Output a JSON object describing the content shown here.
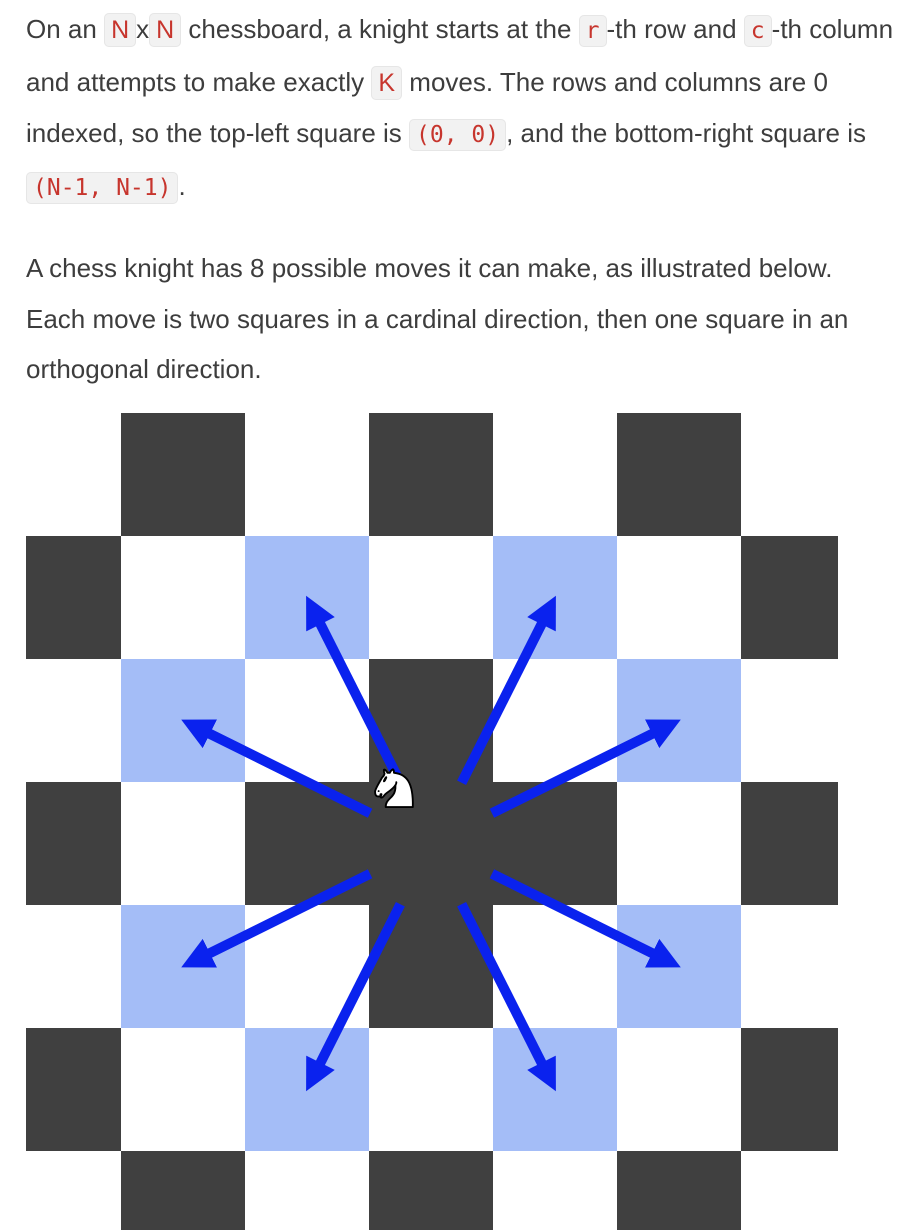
{
  "paragraph1": {
    "t1": "On an ",
    "code_n1": "N",
    "t2": "x",
    "code_n2": "N",
    "t3": " chessboard, a knight starts at the ",
    "code_r": "r",
    "t4": "-th row and ",
    "code_c": "c",
    "t5": "-th column and attempts to make exactly ",
    "code_k": "K",
    "t6": " moves. The rows and columns are 0 indexed, so the top-left square is ",
    "code_origin": "(0, 0)",
    "t7": ", and the bottom-right square is ",
    "code_end": "(N-1, N-1)",
    "t8": "."
  },
  "paragraph2": {
    "text": "A chess knight has 8 possible moves it can make, as illustrated below. Each move is two squares in a cardinal direction, then one square in an orthogonal direction."
  },
  "diagram": {
    "dark_color": "#404040",
    "light_color": "#ffffff",
    "highlight_color": "#a4bdf7",
    "arrow_color": "#0a22ee",
    "knight_icon": "white-knight-icon",
    "knight_square": [
      3,
      3
    ],
    "highlighted_squares": [
      [
        1,
        2
      ],
      [
        1,
        4
      ],
      [
        2,
        1
      ],
      [
        2,
        5
      ],
      [
        4,
        1
      ],
      [
        4,
        5
      ],
      [
        5,
        2
      ],
      [
        5,
        4
      ]
    ]
  }
}
